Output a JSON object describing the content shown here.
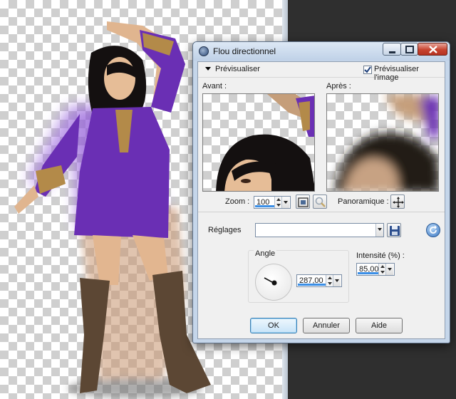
{
  "dialog": {
    "title": "Flou directionnel",
    "preview_section_label": "Prévisualiser",
    "preview_checkbox_label": "Prévisualiser l'image",
    "preview_checked": true,
    "before_label": "Avant :",
    "after_label": "Après :",
    "zoom_label": "Zoom :",
    "zoom_value": "100",
    "pan_label": "Panoramique :",
    "settings_label": "Réglages",
    "settings_value": "",
    "angle_group_label": "Angle",
    "angle_value": "287,00",
    "intensity_label": "Intensité (%) :",
    "intensity_value": "85,00",
    "ok_label": "OK",
    "cancel_label": "Annuler",
    "help_label": "Aide"
  },
  "icons": {
    "title": "app-icon",
    "minimize": "minimize-icon",
    "maximize": "maximize-icon",
    "close": "close-icon",
    "zoom_fit": "fit-window-icon",
    "zoom_magnifier": "magnifier-icon",
    "pan": "move-icon",
    "save": "save-icon",
    "reset": "reset-icon"
  },
  "colors": {
    "accent": "#3a8ee6",
    "dress": "#6a2fb4",
    "title_bar": "#c5d6ea",
    "close_button": "#c7432f"
  }
}
